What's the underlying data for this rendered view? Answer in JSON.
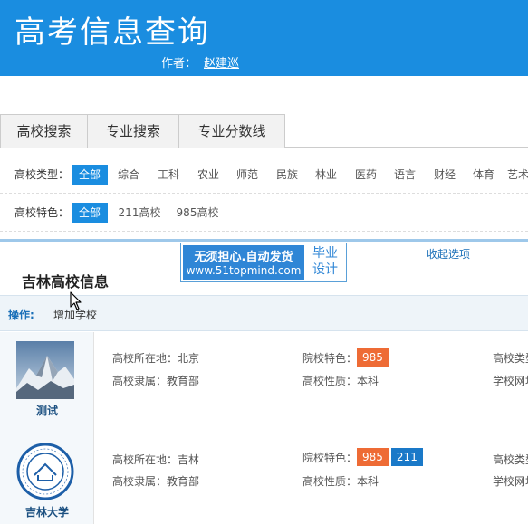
{
  "header": {
    "title": "高考信息查询",
    "author_label": "作者：",
    "author_name": "赵建巡"
  },
  "tabs": [
    {
      "label": "高校搜索"
    },
    {
      "label": "专业搜索"
    },
    {
      "label": "专业分数线"
    }
  ],
  "filters": {
    "type_label": "高校类型：",
    "type_options": [
      "全部",
      "综合",
      "工科",
      "农业",
      "师范",
      "民族",
      "林业",
      "医药",
      "语言",
      "财经",
      "体育",
      "艺术"
    ],
    "feature_label": "高校特色：",
    "feature_options": [
      "全部",
      "211高校",
      "985高校"
    ]
  },
  "ad": {
    "line1": "无须担心.自动发货",
    "line2": "www.51topmind.com",
    "right_line1": "毕业",
    "right_line2": "设计"
  },
  "collapse_label": "收起选项",
  "section_title": "吉林高校信息",
  "ops": {
    "label": "操作:",
    "add": "增加学校"
  },
  "schools": [
    {
      "name": "测试",
      "location": "高校所在地：北京",
      "affiliation": "高校隶属：教育部",
      "feature_label": "院校特色：",
      "nature": "高校性质：本科",
      "type_cut": "高校类型",
      "site_cut": "学校网址",
      "badges": [
        {
          "text": "985",
          "color": "#ee6b35"
        }
      ]
    },
    {
      "name": "吉林大学",
      "location": "高校所在地：吉林",
      "affiliation": "高校隶属：教育部",
      "feature_label": "院校特色：",
      "nature": "高校性质：本科",
      "type_cut": "高校类型",
      "site_cut": "学校网址",
      "badges": [
        {
          "text": "985",
          "color": "#ee6b35"
        },
        {
          "text": "211",
          "color": "#1a79c8"
        }
      ]
    }
  ]
}
